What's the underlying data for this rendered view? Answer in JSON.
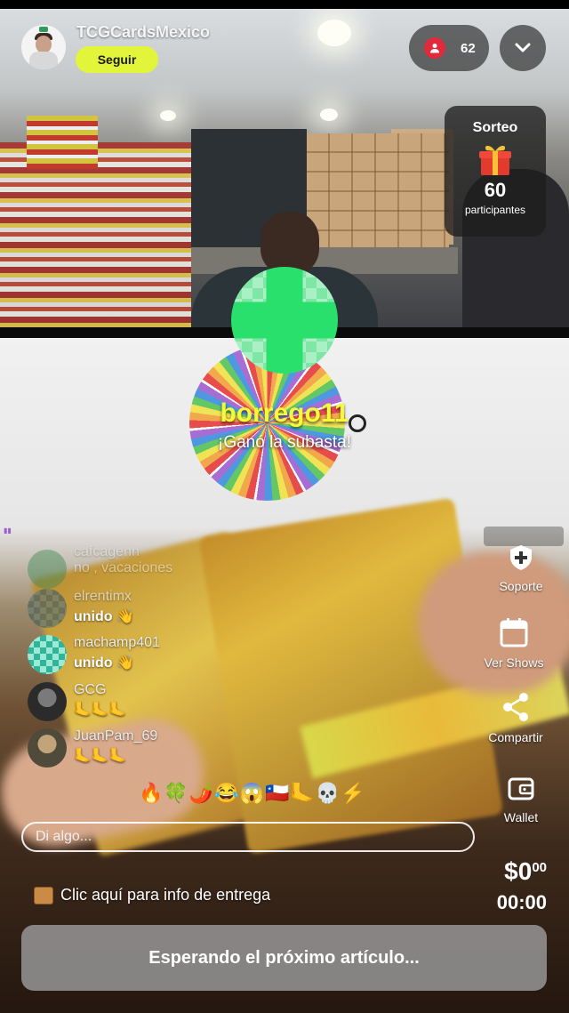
{
  "header": {
    "channel_name": "TCGCardsMexico",
    "follow_label": "Seguir",
    "viewer_count": "62"
  },
  "giveaway": {
    "title": "Sorteo",
    "count": "60",
    "label": "participantes"
  },
  "winner": {
    "username": "borrego11",
    "message": "¡Ganó la subasta!"
  },
  "chat": [
    {
      "user": "cafcagenn",
      "message": "no , vacaciones",
      "faded": true
    },
    {
      "user": "elrentimx",
      "message": "unido 👋"
    },
    {
      "user": "machamp401",
      "message": "unido 👋"
    },
    {
      "user": "GCG",
      "message": "🦶🦶🦶"
    },
    {
      "user": "JuanPam_69",
      "message": "🦶🦶🦶"
    }
  ],
  "quick_reactions": "🔥🍀🌶️😂😱🇨🇱🦶💀⚡",
  "input": {
    "placeholder": "Di algo..."
  },
  "delivery_info": "Clic aquí para info de entrega",
  "sidebar": {
    "support": "Soporte",
    "shows": "Ver Shows",
    "share": "Compartir",
    "wallet": "Wallet"
  },
  "auction": {
    "price": "$0",
    "price_cents": "00",
    "timer": "00:00",
    "status": "Esperando el próximo artículo..."
  }
}
